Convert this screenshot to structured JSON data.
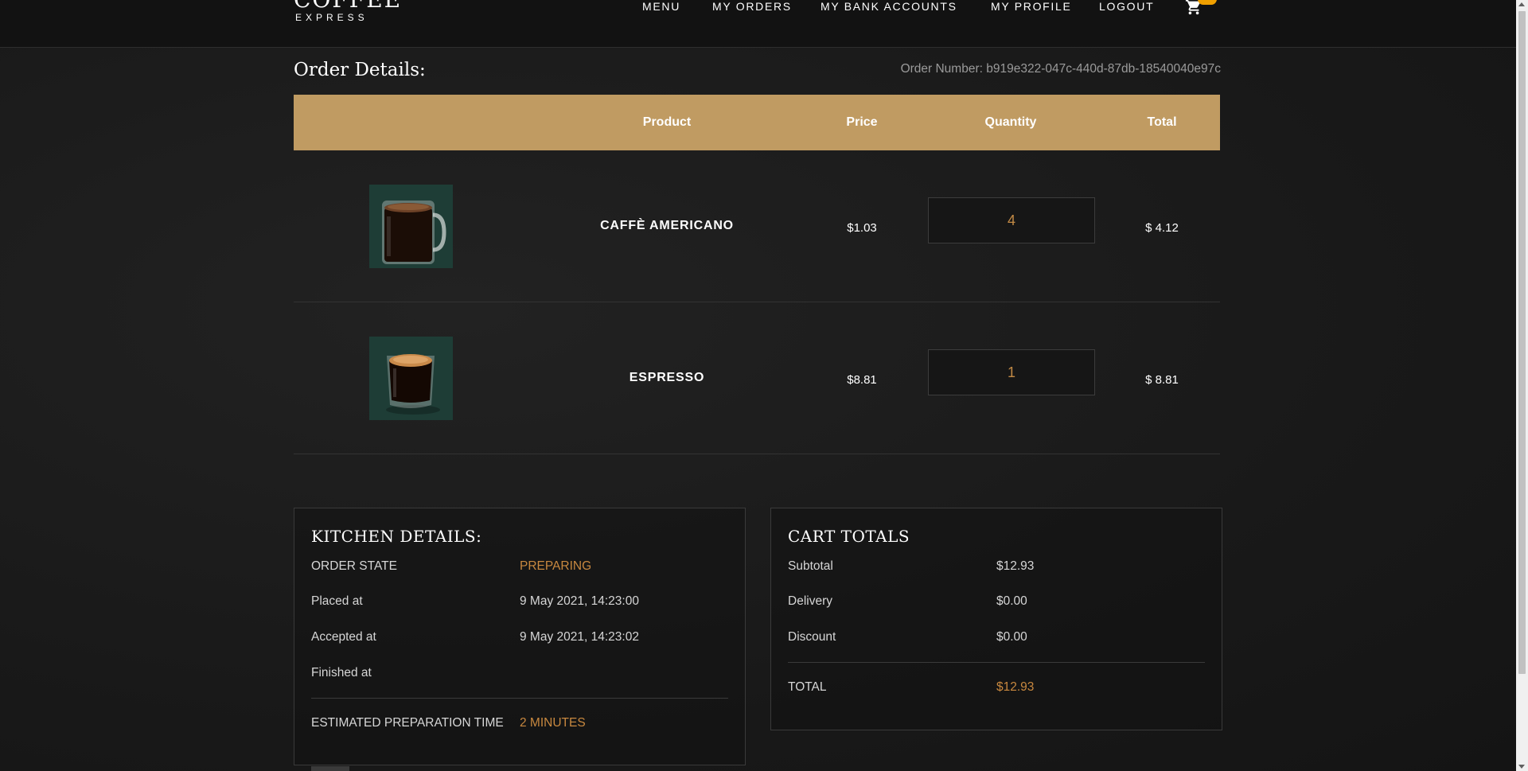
{
  "brand": {
    "line1": "COFFEE",
    "line2": "EXPRESS"
  },
  "nav": {
    "menu": "MENU",
    "orders": "MY ORDERS",
    "bank": "MY BANK ACCOUNTS",
    "profile": "MY PROFILE",
    "logout": "LOGOUT"
  },
  "page": {
    "title": "Order Details:",
    "order_number": "Order Number: b919e322-047c-440d-87db-18540040e97c"
  },
  "table": {
    "headers": {
      "product": "Product",
      "price": "Price",
      "quantity": "Quantity",
      "total": "Total"
    },
    "rows": [
      {
        "image": "caffe-americano-mug",
        "name": "CAFFÈ AMERICANO",
        "price": "$1.03",
        "quantity": "4",
        "total": "$ 4.12"
      },
      {
        "image": "espresso-glass",
        "name": "ESPRESSO",
        "price": "$8.81",
        "quantity": "1",
        "total": "$ 8.81"
      }
    ]
  },
  "kitchen": {
    "title": "KITCHEN DETAILS:",
    "order_state_label": "ORDER STATE",
    "order_state_value": "PREPARING",
    "placed_label": "Placed at",
    "placed_value": "9 May 2021, 14:23:00",
    "accepted_label": "Accepted at",
    "accepted_value": "9 May 2021, 14:23:02",
    "finished_label": "Finished at",
    "finished_value": "",
    "estimated_label": "ESTIMATED PREPARATION TIME",
    "estimated_value": "2 MINUTES"
  },
  "cart_totals": {
    "title": "CART TOTALS",
    "subtotal_label": "Subtotal",
    "subtotal_value": "$12.93",
    "delivery_label": "Delivery",
    "delivery_value": "$0.00",
    "discount_label": "Discount",
    "discount_value": "$0.00",
    "total_label": "TOTAL",
    "total_value": "$12.93"
  },
  "colors": {
    "accent": "#c8883f",
    "header_band": "#c09b62",
    "background": "#1a1a1a",
    "badge": "#f0a000"
  }
}
